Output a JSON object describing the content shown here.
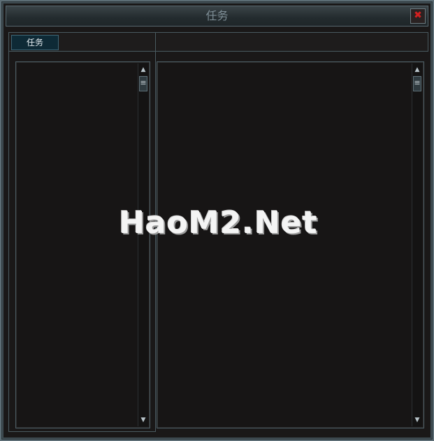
{
  "window": {
    "title": "任务",
    "close_icon_glyph": "✖",
    "accent_color": "#0e2a36"
  },
  "tabs": [
    {
      "label": "任务",
      "selected": true
    }
  ],
  "left_panel": {
    "scroll_up_glyph": "▲",
    "scroll_down_glyph": "▼",
    "scroll_thumb_glyph": "≡"
  },
  "right_panel": {
    "scroll_up_glyph": "▲",
    "scroll_down_glyph": "▼",
    "scroll_thumb_glyph": "≡"
  },
  "watermark": {
    "text": "HaoM2.Net"
  }
}
